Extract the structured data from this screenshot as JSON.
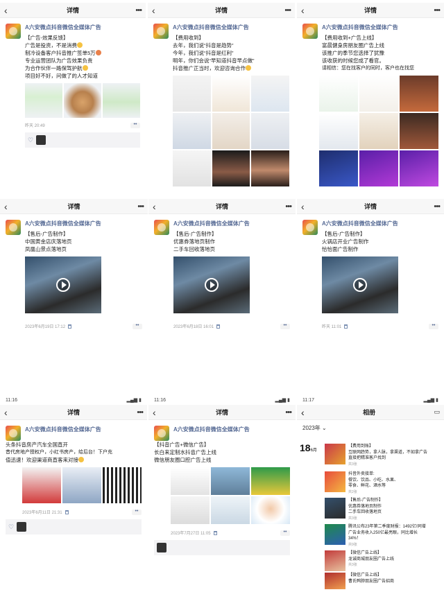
{
  "common": {
    "nav_title": "详情",
    "author": "A六安微点抖音微信全媒体广告",
    "album_title": "相册"
  },
  "panels": [
    {
      "lines": [
        "【广告-效果反馈】",
        "广告是投资，不是消费",
        "制冷设备客户抖音推广签单5万",
        "专业运营团队为广告效果负责",
        "为合作伙伴一路保驾护航",
        "项目好不好，问做了的人才知道"
      ],
      "time": "昨天 20:49"
    },
    {
      "lines": [
        "【费用收到】",
        "去年，我们说“抖音是趋势”",
        "今年，我们说“抖音是红利”",
        "明年，你们会说“早知道抖音早点做”",
        "抖音推广正当时，欢迎咨询合作"
      ]
    },
    {
      "lines": [
        "【费用收到+广告上线】",
        "富晨健身房朋友圈广告上线",
        "该推广的季节您选择了犹豫",
        "该收获的时候您成了看官。",
        "请相信：您在找客户的同时，客户也在找您"
      ]
    },
    {
      "lines": [
        "【售后-广告制作】",
        "中国黄金店庆落地页",
        "凤凰山景点落地页"
      ],
      "time": "2023年6月19日 17:12"
    },
    {
      "lines": [
        "【售后-广告制作】",
        "优惠券落地页制作",
        "二手车回收落地页"
      ],
      "time": "2023年6月18日 16:01"
    },
    {
      "lines": [
        "【售后-广告制作】",
        "火锅店开业广告制作",
        "恰恰面广告制作"
      ],
      "time": "昨天 11:01"
    },
    {
      "status_time": "11:16",
      "lines": [
        "头条抖音房产汽车全国直开",
        "昔代房地产授权户，小红书房产，给后台！下户充",
        "值迅速！欢迎渠道商直客来对接"
      ],
      "time": "2023年6月11日 21:31"
    },
    {
      "status_time": "11:16",
      "lines": [
        "【抖音广告+微信广告】",
        "长白来定制水抖音广告上线",
        "微信朋友圈口腔广告上线"
      ],
      "time": "2023年7月27日 11:05"
    }
  ],
  "album": {
    "status_time": "11:17",
    "year": "2023年",
    "day": "18",
    "month": "6月",
    "entries": [
      {
        "lines": [
          "【费用到账】",
          "互联网趋势，拿人脉，拿渠道，不如拿广告",
          "直接把精准客户找到"
        ],
        "count": "共3张"
      },
      {
        "lines": [
          "抖音外卖接单:",
          "餐饮、饮品、小吃、水果、",
          "零食、鲜花、酒水等"
        ],
        "count": "共2张"
      },
      {
        "lines": [
          "【售后-广告制作】",
          "优惠券落地页制作",
          "二手车回收落地页"
        ],
        "count": "共3张"
      },
      {
        "lines": [
          "腾讯公布23年第二季度财报：1492亿!同增",
          "广告业务收入250亿最亮眼，同比增长",
          "34%！"
        ],
        "count": "共9张"
      },
      {
        "lines": [
          "【微信广告上线】",
          "龙诚商城朋友圈广告上线"
        ],
        "count": "共3张"
      },
      {
        "lines": [
          "【微信广告上线】",
          "曹氏鸭脖朋友圈广告招商"
        ],
        "count": "共3张"
      }
    ]
  }
}
